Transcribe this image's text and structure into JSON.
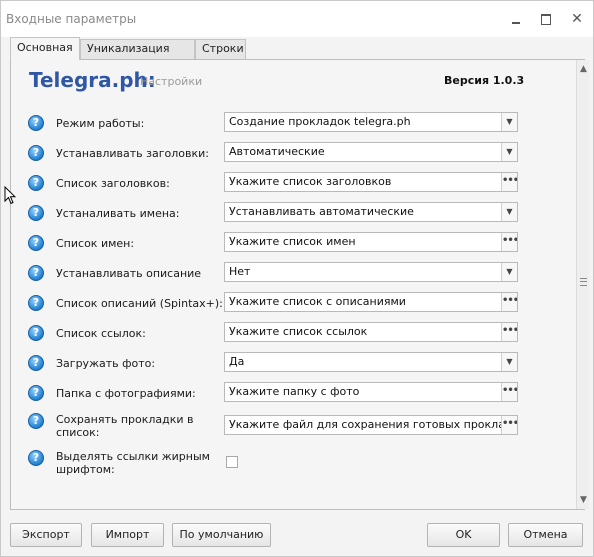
{
  "window": {
    "title": "Входные параметры"
  },
  "tabs": [
    {
      "label": "Основная",
      "active": true
    },
    {
      "label": "Уникализация фото",
      "active": false
    },
    {
      "label": "Строки",
      "active": false
    }
  ],
  "header": {
    "brand": "Telegra.ph:",
    "subtitle": "Настройки",
    "version": "Версия 1.0.3"
  },
  "settings": [
    {
      "label": "Режим работы:",
      "value": "Создание прокладок telegra.ph",
      "control": "dropdown"
    },
    {
      "label": "Устанавливать заголовки:",
      "value": "Автоматические",
      "control": "dropdown"
    },
    {
      "label": "Список заголовков:",
      "value": "Укажите список заголовков",
      "control": "browse"
    },
    {
      "label": "Устаналивать имена:",
      "value": "Устанавливать автоматические",
      "control": "dropdown"
    },
    {
      "label": "Список имен:",
      "value": "Укажите список имен",
      "control": "browse"
    },
    {
      "label": "Устанавливать описание",
      "value": "Нет",
      "control": "dropdown"
    },
    {
      "label": "Список описаний (Spintax+):",
      "value": "Укажите список с описаниями",
      "control": "browse"
    },
    {
      "label": "Список ссылок:",
      "value": "Укажите список ссылок",
      "control": "browse"
    },
    {
      "label": "Загружать фото:",
      "value": "Да",
      "control": "dropdown"
    },
    {
      "label": "Папка с фотографиями:",
      "value": "Укажите папку с фото",
      "control": "browse"
    },
    {
      "label_line1": "Сохранять прокладки в",
      "label_line2": "список:",
      "value": "Укажите файл для сохранения готовых прокладок",
      "control": "browse"
    },
    {
      "label_line1": "Выделять ссылки жирным",
      "label_line2": "шрифтом:",
      "checked": false,
      "control": "checkbox"
    }
  ],
  "footer": {
    "export": "Экспорт",
    "import": "Импорт",
    "defaults": "По умолчанию",
    "ok": "OK",
    "cancel": "Отмена"
  },
  "icons": {
    "help": "?",
    "dropdown": "▼",
    "browse": "•••",
    "scroll_up": "▲",
    "scroll_down": "▼",
    "close": "✕"
  },
  "colors": {
    "brand": "#2f57a5",
    "help_icon": "#1f7fd1"
  }
}
